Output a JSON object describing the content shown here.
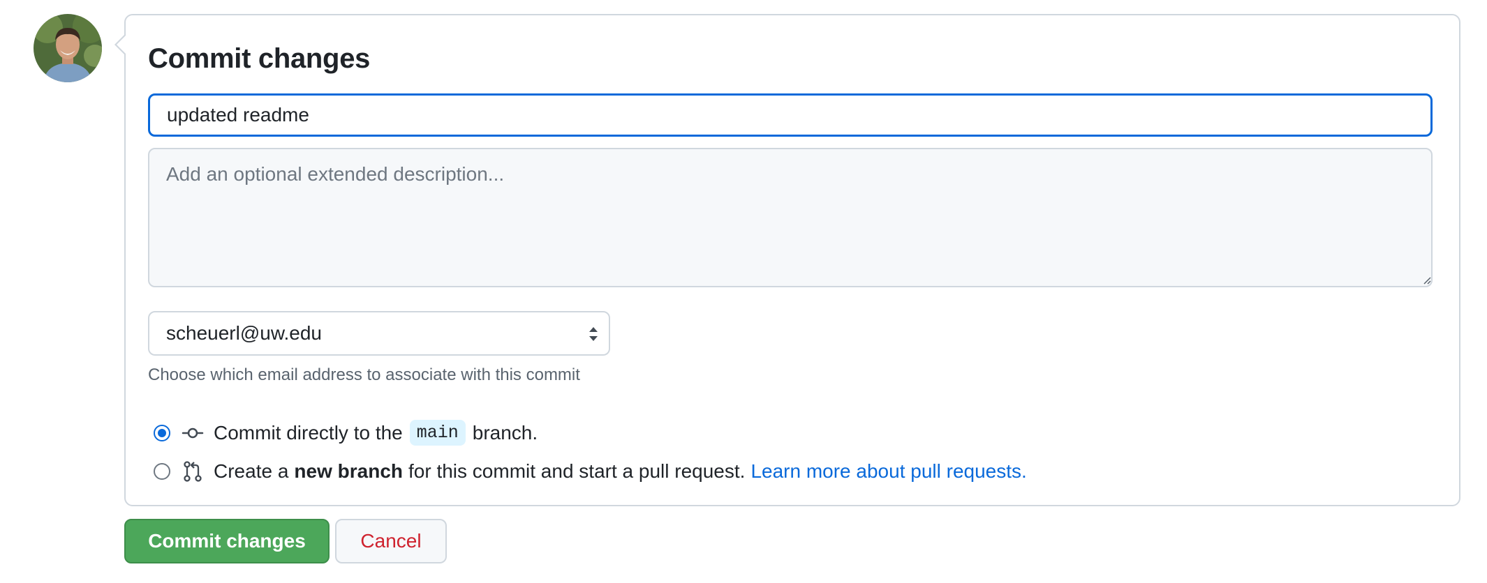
{
  "avatar": {
    "alt": "user avatar"
  },
  "form": {
    "title": "Commit changes",
    "summary_value": "updated readme",
    "description_placeholder": "Add an optional extended description...",
    "email_selected": "scheuerl@uw.edu",
    "email_hint": "Choose which email address to associate with this commit",
    "option_direct": {
      "prefix": "Commit directly to the",
      "branch": "main",
      "suffix": "branch.",
      "icon": "git-commit-icon",
      "selected": true
    },
    "option_new_branch": {
      "prefix": "Create a",
      "bold": "new branch",
      "suffix": "for this commit and start a pull request.",
      "link": "Learn more about pull requests.",
      "icon": "git-pull-request-icon",
      "selected": false
    }
  },
  "actions": {
    "commit_label": "Commit changes",
    "cancel_label": "Cancel"
  },
  "colors": {
    "accent": "#0969da",
    "commit_button": "#4ca75a",
    "cancel_text": "#cf222e"
  }
}
